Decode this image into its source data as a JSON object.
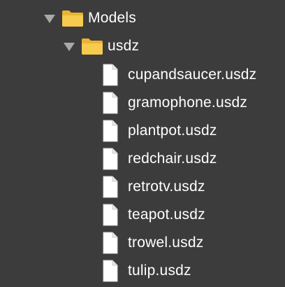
{
  "tree": {
    "root": {
      "label": "Models",
      "icon": "folder-icon",
      "expanded": true
    },
    "child": {
      "label": "usdz",
      "icon": "folder-icon",
      "expanded": true
    },
    "files": [
      {
        "label": "cupandsaucer.usdz",
        "icon": "document-icon"
      },
      {
        "label": "gramophone.usdz",
        "icon": "document-icon"
      },
      {
        "label": "plantpot.usdz",
        "icon": "document-icon"
      },
      {
        "label": "redchair.usdz",
        "icon": "document-icon"
      },
      {
        "label": "retrotv.usdz",
        "icon": "document-icon"
      },
      {
        "label": "teapot.usdz",
        "icon": "document-icon"
      },
      {
        "label": "trowel.usdz",
        "icon": "document-icon"
      },
      {
        "label": "tulip.usdz",
        "icon": "document-icon"
      }
    ]
  },
  "colors": {
    "background": "#3c3c3c",
    "text": "#ffffff",
    "folder": "#f5c542",
    "disclosure": "#a9a9a9",
    "file_icon": "#ffffff"
  }
}
